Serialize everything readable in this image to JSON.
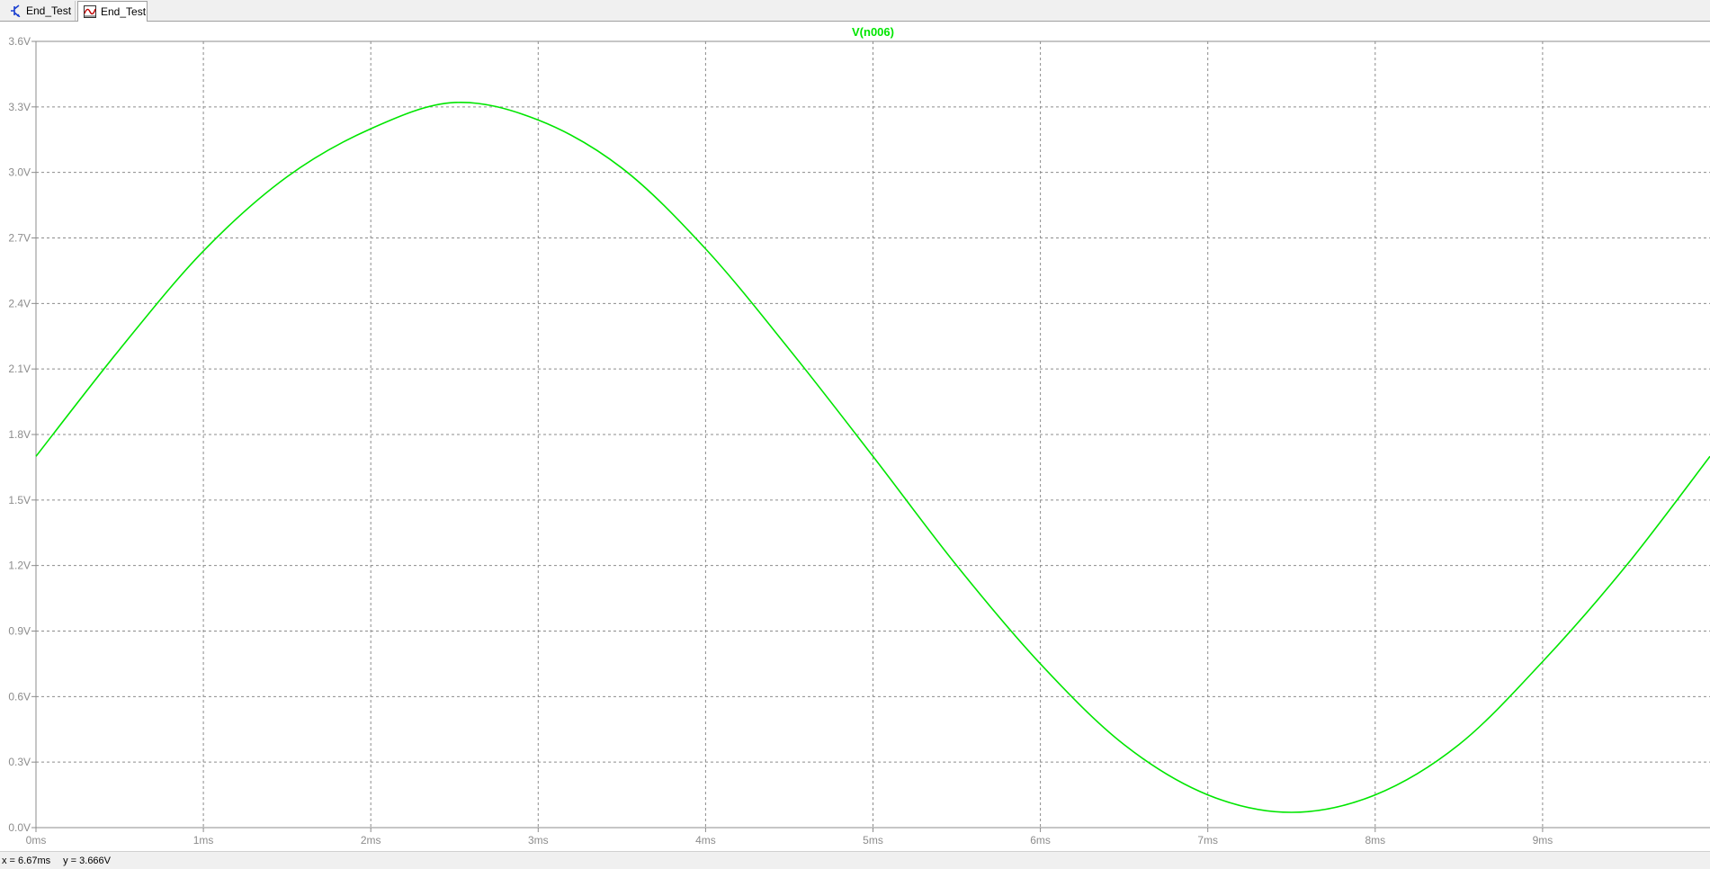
{
  "tabs": [
    {
      "label": "End_Test",
      "icon": "schematic-icon",
      "active": false
    },
    {
      "label": "End_Test",
      "icon": "waveform-icon",
      "active": true
    }
  ],
  "status": {
    "x_readout": "x = 6.67ms",
    "y_readout": "y = 3.666V"
  },
  "colors": {
    "trace": "#00e600",
    "grid": "#8c8c8c",
    "axis_text": "#8c8c8c",
    "background": "#ffffff"
  },
  "chart_data": {
    "type": "line",
    "title": "V(n006)",
    "xlabel": "",
    "ylabel": "",
    "xlim": [
      0,
      10
    ],
    "ylim": [
      0,
      3.6
    ],
    "grid": true,
    "x_ticks": [
      0,
      1,
      2,
      3,
      4,
      5,
      6,
      7,
      8,
      9
    ],
    "x_tick_labels": [
      "0ms",
      "1ms",
      "2ms",
      "3ms",
      "4ms",
      "5ms",
      "6ms",
      "7ms",
      "8ms",
      "9ms"
    ],
    "y_ticks": [
      0,
      0.3,
      0.6,
      0.9,
      1.2,
      1.5,
      1.8,
      2.1,
      2.4,
      2.7,
      3.0,
      3.3,
      3.6
    ],
    "y_tick_labels": [
      "0.0V",
      "0.3V",
      "0.6V",
      "0.9V",
      "1.2V",
      "1.5V",
      "1.8V",
      "2.1V",
      "2.4V",
      "2.7V",
      "3.0V",
      "3.3V",
      "3.6V"
    ],
    "series": [
      {
        "name": "V(n006)",
        "x": [
          0,
          0.5,
          1,
          1.5,
          2,
          2.5,
          3,
          3.5,
          4,
          4.5,
          5,
          5.5,
          6,
          6.5,
          7,
          7.5,
          8,
          8.5,
          9,
          9.5,
          10
        ],
        "y": [
          1.7,
          2.19,
          2.64,
          2.98,
          3.2,
          3.32,
          3.24,
          3.02,
          2.65,
          2.19,
          1.7,
          1.2,
          0.75,
          0.38,
          0.15,
          0.07,
          0.15,
          0.38,
          0.76,
          1.2,
          1.7
        ]
      }
    ]
  }
}
